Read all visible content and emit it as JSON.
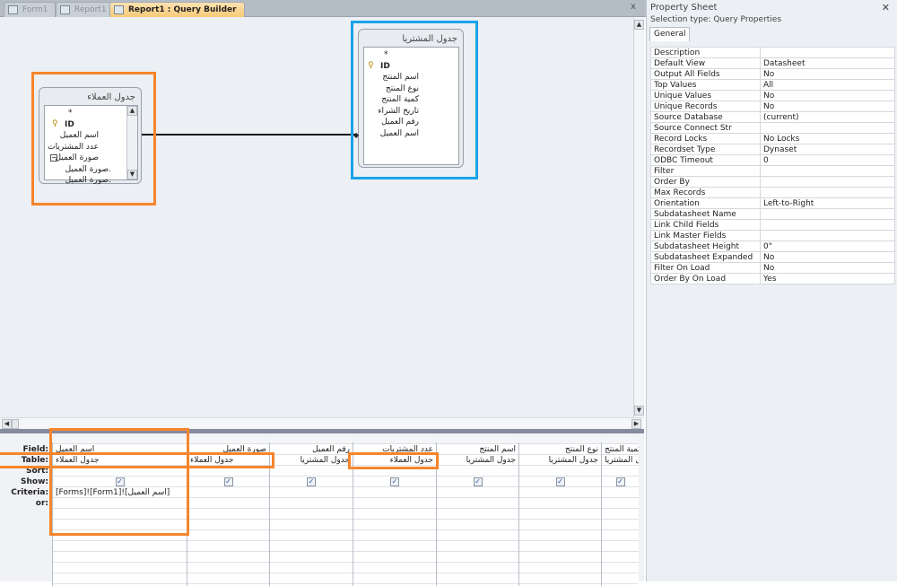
{
  "tabs": [
    {
      "label": "Form1"
    },
    {
      "label": "Report1"
    },
    {
      "label": "Report1 : Query Builder",
      "active": true
    }
  ],
  "close_glyph": "x",
  "tables": [
    {
      "title": "جدول العملاء",
      "fields": [
        "*",
        "ID",
        "اسم العميل",
        "عدد المشتريات",
        "صورة العميل",
        "صورة العميل.",
        "صورة العميل."
      ]
    },
    {
      "title": "جدول المشتريا",
      "fields": [
        "*",
        "ID",
        "اسم المنتج",
        "نوع المنتج",
        "كمية المنتج",
        "تاريخ الشراء",
        "رقم العميل",
        "اسم العميل"
      ]
    }
  ],
  "grid": {
    "row_labels": [
      "Field:",
      "Table:",
      "Sort:",
      "Show:",
      "Criteria:",
      "or:"
    ],
    "columns": [
      {
        "field": "اسم العميل",
        "table": "جدول العملاء",
        "show": true,
        "criteria": "[Forms]![Form1]![اسم العميل]"
      },
      {
        "field": "صورة العميل",
        "table": "جدول العملاء",
        "show": true,
        "criteria": ""
      },
      {
        "field": "رقم العميل",
        "table": "جدول المشتريا",
        "show": true,
        "criteria": ""
      },
      {
        "field": "عدد المشتريات",
        "table": "جدول العملاء",
        "show": true,
        "criteria": ""
      },
      {
        "field": "اسم المنتج",
        "table": "جدول المشتريا",
        "show": true,
        "criteria": ""
      },
      {
        "field": "نوع المنتج",
        "table": "جدول المشتريا",
        "show": true,
        "criteria": ""
      },
      {
        "field": "كمية المنتج",
        "table": "جدول المشتريا",
        "show": true,
        "criteria": ""
      }
    ]
  },
  "property_sheet": {
    "title": "Property Sheet",
    "selection_type": "Selection type:  Query Properties",
    "tab": "General",
    "rows": [
      [
        "Description",
        ""
      ],
      [
        "Default View",
        "Datasheet"
      ],
      [
        "Output All Fields",
        "No"
      ],
      [
        "Top Values",
        "All"
      ],
      [
        "Unique Values",
        "No"
      ],
      [
        "Unique Records",
        "No"
      ],
      [
        "Source Database",
        "(current)"
      ],
      [
        "Source Connect Str",
        ""
      ],
      [
        "Record Locks",
        "No Locks"
      ],
      [
        "Recordset Type",
        "Dynaset"
      ],
      [
        "ODBC Timeout",
        "0"
      ],
      [
        "Filter",
        ""
      ],
      [
        "Order By",
        ""
      ],
      [
        "Max Records",
        ""
      ],
      [
        "Orientation",
        "Left-to-Right"
      ],
      [
        "Subdatasheet Name",
        ""
      ],
      [
        "Link Child Fields",
        ""
      ],
      [
        "Link Master Fields",
        ""
      ],
      [
        "Subdatasheet Height",
        "0\""
      ],
      [
        "Subdatasheet Expanded",
        "No"
      ],
      [
        "Filter On Load",
        "No"
      ],
      [
        "Order By On Load",
        "Yes"
      ]
    ]
  },
  "colors": {
    "highlight_orange": "#f7852b",
    "highlight_blue": "#1aa3e8"
  }
}
